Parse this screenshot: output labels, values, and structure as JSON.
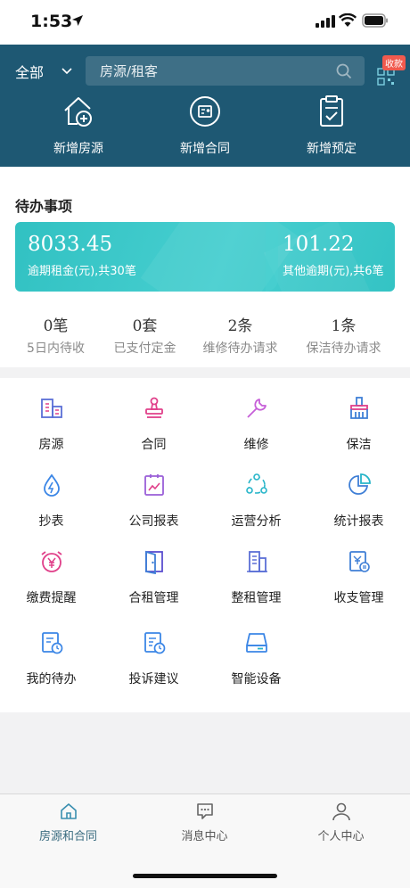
{
  "status_bar": {
    "time": "1:53"
  },
  "header": {
    "city": "全部",
    "search_placeholder": "房源/租客",
    "collect_badge": "收款",
    "quick_actions": [
      {
        "label": "新增房源",
        "icon": "add-house-icon"
      },
      {
        "label": "新增合同",
        "icon": "contract-icon"
      },
      {
        "label": "新增预定",
        "icon": "clipboard-check-icon"
      }
    ]
  },
  "todo": {
    "title": "待办事项",
    "overdue_rent": {
      "value": "8033.45",
      "label": "逾期租金(元),共30笔"
    },
    "other_overdue": {
      "value": "101.22",
      "label": "其他逾期(元),共6笔"
    },
    "stats": [
      {
        "count": "0笔",
        "label": "5日内待收"
      },
      {
        "count": "0套",
        "label": "已支付定金"
      },
      {
        "count": "2条",
        "label": "维修待办请求"
      },
      {
        "count": "1条",
        "label": "保洁待办请求"
      }
    ]
  },
  "modules": [
    {
      "label": "房源",
      "icon": "building-icon",
      "color": "#5b6fd6"
    },
    {
      "label": "合同",
      "icon": "stamp-icon",
      "color": "#e0408a"
    },
    {
      "label": "维修",
      "icon": "wrench-icon",
      "color": "#c65fd8"
    },
    {
      "label": "保洁",
      "icon": "broom-icon",
      "color": "#3f7fd6"
    },
    {
      "label": "抄表",
      "icon": "water-drop-icon",
      "color": "#3b86e6"
    },
    {
      "label": "公司报表",
      "icon": "report-icon",
      "color": "#9a5fd8"
    },
    {
      "label": "运营分析",
      "icon": "cycle-icon",
      "color": "#27b5c9"
    },
    {
      "label": "统计报表",
      "icon": "pie-chart-icon",
      "color": "#3f7fd6"
    },
    {
      "label": "缴费提醒",
      "icon": "alarm-yen-icon",
      "color": "#e0408a"
    },
    {
      "label": "合租管理",
      "icon": "door-icon",
      "color": "#5b4fd0"
    },
    {
      "label": "整租管理",
      "icon": "office-building-icon",
      "color": "#5b6fd6"
    },
    {
      "label": "收支管理",
      "icon": "ledger-icon",
      "color": "#3f7fd6"
    },
    {
      "label": "我的待办",
      "icon": "todo-clock-icon",
      "color": "#3b86e6"
    },
    {
      "label": "投诉建议",
      "icon": "complaint-icon",
      "color": "#3b86e6"
    },
    {
      "label": "智能设备",
      "icon": "device-icon",
      "color": "#3b86e6"
    }
  ],
  "tabbar": [
    {
      "label": "房源和合同",
      "icon": "home-icon",
      "active": true
    },
    {
      "label": "消息中心",
      "icon": "message-icon",
      "active": false
    },
    {
      "label": "个人中心",
      "icon": "person-icon",
      "active": false
    }
  ],
  "colors": {
    "header_bg": "#1e5873",
    "card_teal": "#3cc8c9",
    "badge_red": "#f05a4e"
  }
}
